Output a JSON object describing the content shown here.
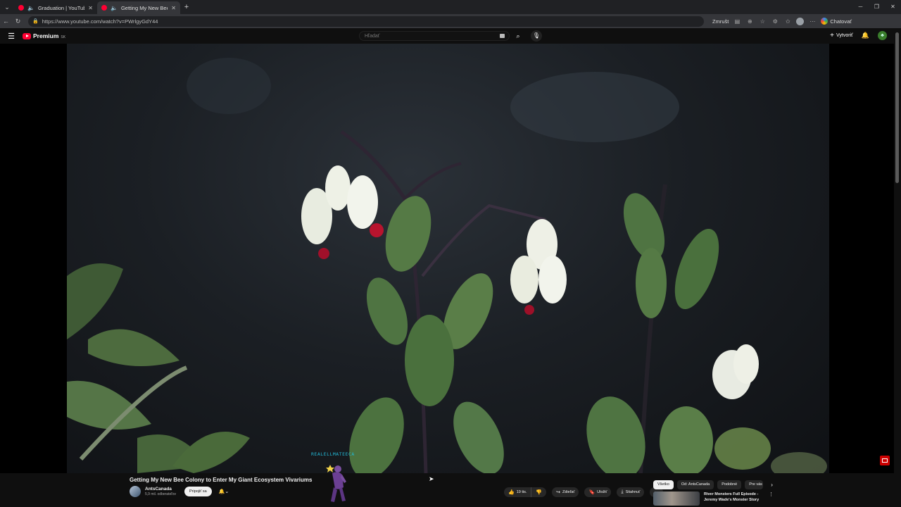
{
  "browser": {
    "tabs": [
      {
        "title": "Graduation | YouTube Music",
        "active": false
      },
      {
        "title": "Getting My New Bee Colony",
        "active": true
      }
    ],
    "url": "https://www.youtube.com/watch?v=PWrlgyGdY44",
    "zoom_label": "Zmrušt",
    "copilot_label": "Chatovať"
  },
  "youtube": {
    "logo_text": "Premium",
    "logo_region": "SK",
    "search_placeholder": "Hľadať",
    "create_label": "Vytvoriť"
  },
  "video": {
    "watermark": "REALELLMATEECA",
    "title": "Getting My New Bee Colony to Enter My Giant Ecosystem Vivariums",
    "channel_name": "AntsCanada",
    "subscribers": "5,9 mil. odberateľov",
    "join_label": "Pripojiť sa",
    "likes": "19 tis.",
    "share_label": "Zdieľať",
    "save_label": "Uložiť",
    "download_label": "Stiahnuť"
  },
  "sidebar": {
    "chips": [
      "Všetko",
      "Od: AntsCanada",
      "Podobné",
      "Pre vás"
    ],
    "recommendation": {
      "title_line1": "River Monsters Full Episode -",
      "title_line2": "Jeremy Wade's Monster Story"
    }
  },
  "colors": {
    "brand": "#ff0033",
    "background": "#0f0f0f",
    "watermark": "#22b9d6"
  }
}
